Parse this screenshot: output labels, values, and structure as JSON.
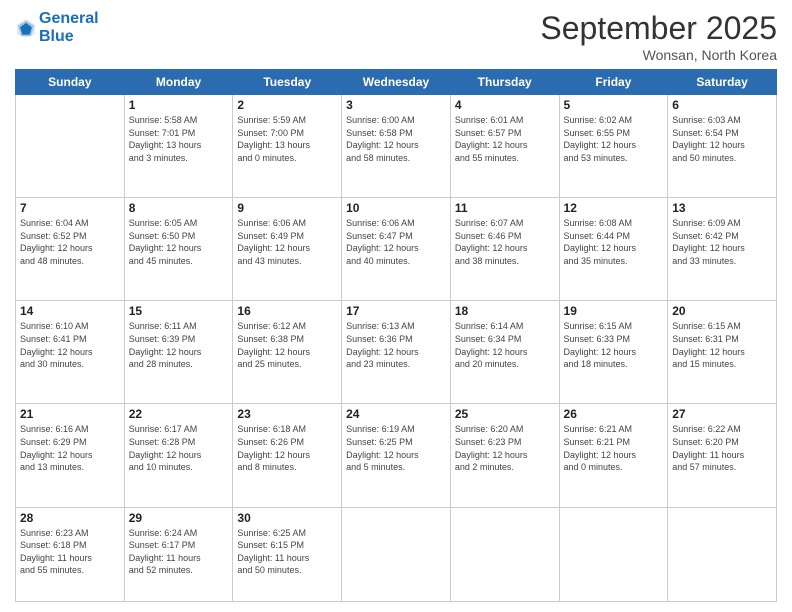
{
  "header": {
    "logo_line1": "General",
    "logo_line2": "Blue",
    "title": "September 2025",
    "location": "Wonsan, North Korea"
  },
  "days_of_week": [
    "Sunday",
    "Monday",
    "Tuesday",
    "Wednesday",
    "Thursday",
    "Friday",
    "Saturday"
  ],
  "weeks": [
    [
      {
        "day": "",
        "info": ""
      },
      {
        "day": "1",
        "info": "Sunrise: 5:58 AM\nSunset: 7:01 PM\nDaylight: 13 hours\nand 3 minutes."
      },
      {
        "day": "2",
        "info": "Sunrise: 5:59 AM\nSunset: 7:00 PM\nDaylight: 13 hours\nand 0 minutes."
      },
      {
        "day": "3",
        "info": "Sunrise: 6:00 AM\nSunset: 6:58 PM\nDaylight: 12 hours\nand 58 minutes."
      },
      {
        "day": "4",
        "info": "Sunrise: 6:01 AM\nSunset: 6:57 PM\nDaylight: 12 hours\nand 55 minutes."
      },
      {
        "day": "5",
        "info": "Sunrise: 6:02 AM\nSunset: 6:55 PM\nDaylight: 12 hours\nand 53 minutes."
      },
      {
        "day": "6",
        "info": "Sunrise: 6:03 AM\nSunset: 6:54 PM\nDaylight: 12 hours\nand 50 minutes."
      }
    ],
    [
      {
        "day": "7",
        "info": "Sunrise: 6:04 AM\nSunset: 6:52 PM\nDaylight: 12 hours\nand 48 minutes."
      },
      {
        "day": "8",
        "info": "Sunrise: 6:05 AM\nSunset: 6:50 PM\nDaylight: 12 hours\nand 45 minutes."
      },
      {
        "day": "9",
        "info": "Sunrise: 6:06 AM\nSunset: 6:49 PM\nDaylight: 12 hours\nand 43 minutes."
      },
      {
        "day": "10",
        "info": "Sunrise: 6:06 AM\nSunset: 6:47 PM\nDaylight: 12 hours\nand 40 minutes."
      },
      {
        "day": "11",
        "info": "Sunrise: 6:07 AM\nSunset: 6:46 PM\nDaylight: 12 hours\nand 38 minutes."
      },
      {
        "day": "12",
        "info": "Sunrise: 6:08 AM\nSunset: 6:44 PM\nDaylight: 12 hours\nand 35 minutes."
      },
      {
        "day": "13",
        "info": "Sunrise: 6:09 AM\nSunset: 6:42 PM\nDaylight: 12 hours\nand 33 minutes."
      }
    ],
    [
      {
        "day": "14",
        "info": "Sunrise: 6:10 AM\nSunset: 6:41 PM\nDaylight: 12 hours\nand 30 minutes."
      },
      {
        "day": "15",
        "info": "Sunrise: 6:11 AM\nSunset: 6:39 PM\nDaylight: 12 hours\nand 28 minutes."
      },
      {
        "day": "16",
        "info": "Sunrise: 6:12 AM\nSunset: 6:38 PM\nDaylight: 12 hours\nand 25 minutes."
      },
      {
        "day": "17",
        "info": "Sunrise: 6:13 AM\nSunset: 6:36 PM\nDaylight: 12 hours\nand 23 minutes."
      },
      {
        "day": "18",
        "info": "Sunrise: 6:14 AM\nSunset: 6:34 PM\nDaylight: 12 hours\nand 20 minutes."
      },
      {
        "day": "19",
        "info": "Sunrise: 6:15 AM\nSunset: 6:33 PM\nDaylight: 12 hours\nand 18 minutes."
      },
      {
        "day": "20",
        "info": "Sunrise: 6:15 AM\nSunset: 6:31 PM\nDaylight: 12 hours\nand 15 minutes."
      }
    ],
    [
      {
        "day": "21",
        "info": "Sunrise: 6:16 AM\nSunset: 6:29 PM\nDaylight: 12 hours\nand 13 minutes."
      },
      {
        "day": "22",
        "info": "Sunrise: 6:17 AM\nSunset: 6:28 PM\nDaylight: 12 hours\nand 10 minutes."
      },
      {
        "day": "23",
        "info": "Sunrise: 6:18 AM\nSunset: 6:26 PM\nDaylight: 12 hours\nand 8 minutes."
      },
      {
        "day": "24",
        "info": "Sunrise: 6:19 AM\nSunset: 6:25 PM\nDaylight: 12 hours\nand 5 minutes."
      },
      {
        "day": "25",
        "info": "Sunrise: 6:20 AM\nSunset: 6:23 PM\nDaylight: 12 hours\nand 2 minutes."
      },
      {
        "day": "26",
        "info": "Sunrise: 6:21 AM\nSunset: 6:21 PM\nDaylight: 12 hours\nand 0 minutes."
      },
      {
        "day": "27",
        "info": "Sunrise: 6:22 AM\nSunset: 6:20 PM\nDaylight: 11 hours\nand 57 minutes."
      }
    ],
    [
      {
        "day": "28",
        "info": "Sunrise: 6:23 AM\nSunset: 6:18 PM\nDaylight: 11 hours\nand 55 minutes."
      },
      {
        "day": "29",
        "info": "Sunrise: 6:24 AM\nSunset: 6:17 PM\nDaylight: 11 hours\nand 52 minutes."
      },
      {
        "day": "30",
        "info": "Sunrise: 6:25 AM\nSunset: 6:15 PM\nDaylight: 11 hours\nand 50 minutes."
      },
      {
        "day": "",
        "info": ""
      },
      {
        "day": "",
        "info": ""
      },
      {
        "day": "",
        "info": ""
      },
      {
        "day": "",
        "info": ""
      }
    ]
  ]
}
